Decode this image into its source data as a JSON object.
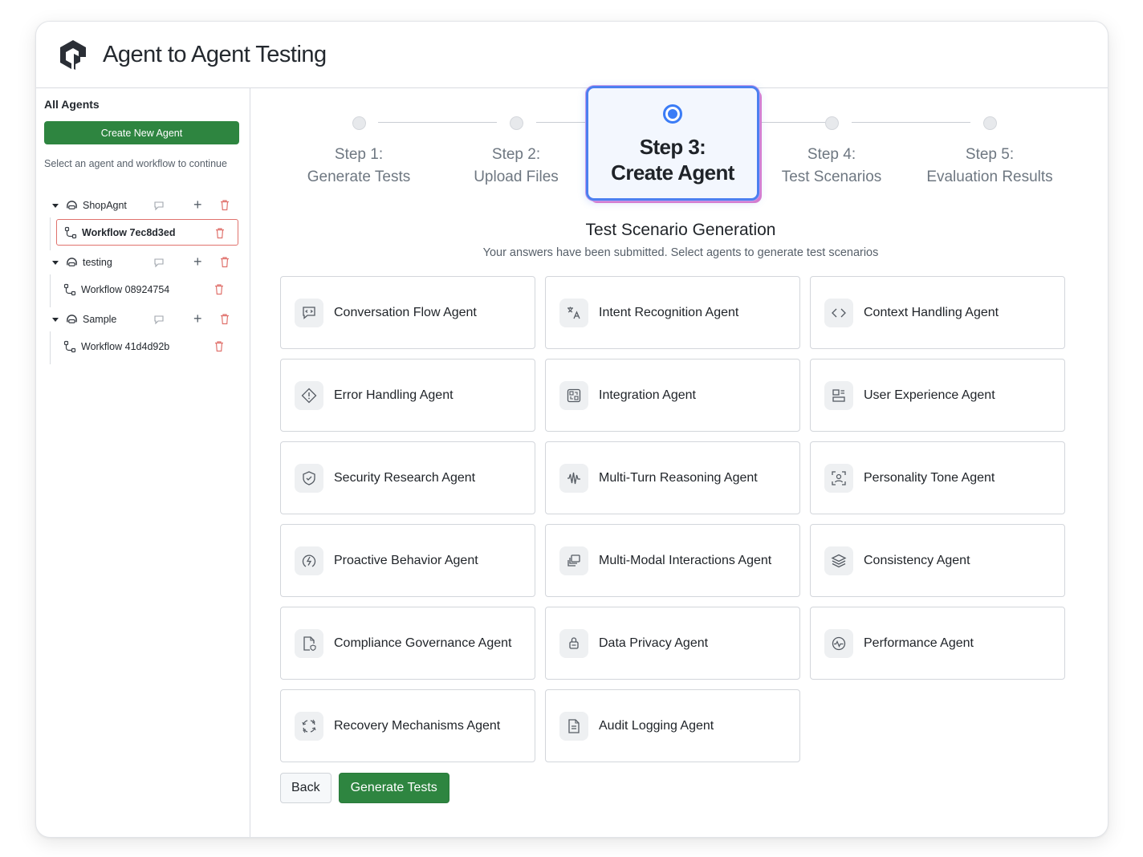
{
  "app": {
    "title": "Agent to Agent Testing"
  },
  "sidebar": {
    "title": "All Agents",
    "create_button": "Create New Agent",
    "hint": "Select an agent and workflow to continue",
    "agents": [
      {
        "name": "ShopAgnt",
        "workflow": "Workflow 7ec8d3ed",
        "selected": true
      },
      {
        "name": "testing",
        "workflow": "Workflow 08924754",
        "selected": false
      },
      {
        "name": "Sample",
        "workflow": "Workflow 41d4d92b",
        "selected": false
      }
    ]
  },
  "stepper": {
    "steps": [
      {
        "line1": "Step 1:",
        "line2": "Generate Tests"
      },
      {
        "line1": "Step 2:",
        "line2": "Upload Files"
      },
      {
        "line1": "Step 3:",
        "line2": "Create Agent"
      },
      {
        "line1": "Step 4:",
        "line2": "Test Scenarios"
      },
      {
        "line1": "Step 5:",
        "line2": "Evaluation Results"
      }
    ],
    "active_index": 2
  },
  "section": {
    "title": "Test Scenario Generation",
    "subtitle": "Your answers have been submitted. Select agents to generate test scenarios"
  },
  "agent_cards": [
    {
      "label": "Conversation Flow Agent",
      "icon": "code-chat-icon"
    },
    {
      "label": "Intent Recognition Agent",
      "icon": "translate-icon"
    },
    {
      "label": "Context Handling Agent",
      "icon": "code-brackets-icon"
    },
    {
      "label": "Error Handling Agent",
      "icon": "warning-diamond-icon"
    },
    {
      "label": "Integration Agent",
      "icon": "integration-icon"
    },
    {
      "label": "User Experience Agent",
      "icon": "layout-icon"
    },
    {
      "label": "Security Research Agent",
      "icon": "shield-check-icon"
    },
    {
      "label": "Multi-Turn Reasoning Agent",
      "icon": "waveform-icon"
    },
    {
      "label": "Personality Tone Agent",
      "icon": "user-focus-icon"
    },
    {
      "label": "Proactive Behavior Agent",
      "icon": "bolt-circle-icon"
    },
    {
      "label": "Multi-Modal Interactions Agent",
      "icon": "stack-copy-icon"
    },
    {
      "label": "Consistency Agent",
      "icon": "layers-icon"
    },
    {
      "label": "Compliance Governance Agent",
      "icon": "file-shield-icon"
    },
    {
      "label": "Data Privacy Agent",
      "icon": "lock-hand-icon"
    },
    {
      "label": "Performance Agent",
      "icon": "activity-circle-icon"
    },
    {
      "label": "Recovery Mechanisms Agent",
      "icon": "refresh-arrows-icon"
    },
    {
      "label": "Audit Logging Agent",
      "icon": "file-list-icon"
    }
  ],
  "actions": {
    "back": "Back",
    "generate": "Generate Tests"
  },
  "colors": {
    "primary_green": "#2e8540",
    "active_blue": "#4c7ff0",
    "danger_red": "#e0726d"
  }
}
